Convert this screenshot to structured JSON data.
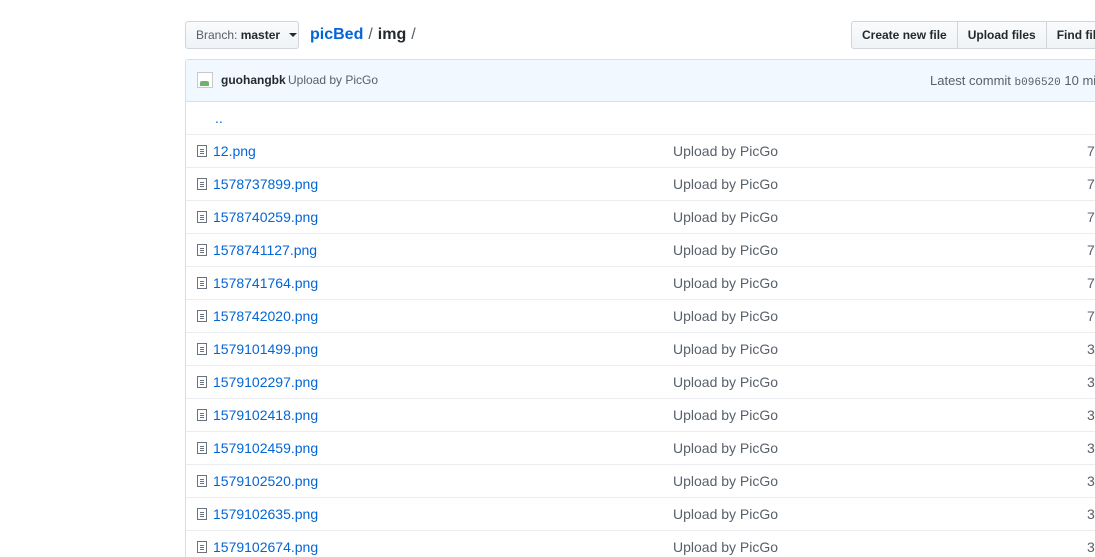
{
  "branch": {
    "label": "Branch:",
    "value": "master"
  },
  "breadcrumb": {
    "repo": "picBed",
    "separator": "/",
    "dir": "img",
    "trailing": "/"
  },
  "actions": {
    "create": "Create new file",
    "upload": "Upload files",
    "find": "Find file"
  },
  "commit": {
    "author": "guohangbk",
    "message": "Upload by PicGo",
    "latest_label": "Latest commit",
    "sha": "b096520",
    "age": "10 mi"
  },
  "parent_dir": "..",
  "files": [
    {
      "name": "12.png",
      "message": "Upload by PicGo",
      "age": "7"
    },
    {
      "name": "1578737899.png",
      "message": "Upload by PicGo",
      "age": "7"
    },
    {
      "name": "1578740259.png",
      "message": "Upload by PicGo",
      "age": "7"
    },
    {
      "name": "1578741127.png",
      "message": "Upload by PicGo",
      "age": "7"
    },
    {
      "name": "1578741764.png",
      "message": "Upload by PicGo",
      "age": "7"
    },
    {
      "name": "1578742020.png",
      "message": "Upload by PicGo",
      "age": "7"
    },
    {
      "name": "1579101499.png",
      "message": "Upload by PicGo",
      "age": "3"
    },
    {
      "name": "1579102297.png",
      "message": "Upload by PicGo",
      "age": "3"
    },
    {
      "name": "1579102418.png",
      "message": "Upload by PicGo",
      "age": "3"
    },
    {
      "name": "1579102459.png",
      "message": "Upload by PicGo",
      "age": "3"
    },
    {
      "name": "1579102520.png",
      "message": "Upload by PicGo",
      "age": "3"
    },
    {
      "name": "1579102635.png",
      "message": "Upload by PicGo",
      "age": "3"
    },
    {
      "name": "1579102674.png",
      "message": "Upload by PicGo",
      "age": "3"
    }
  ]
}
